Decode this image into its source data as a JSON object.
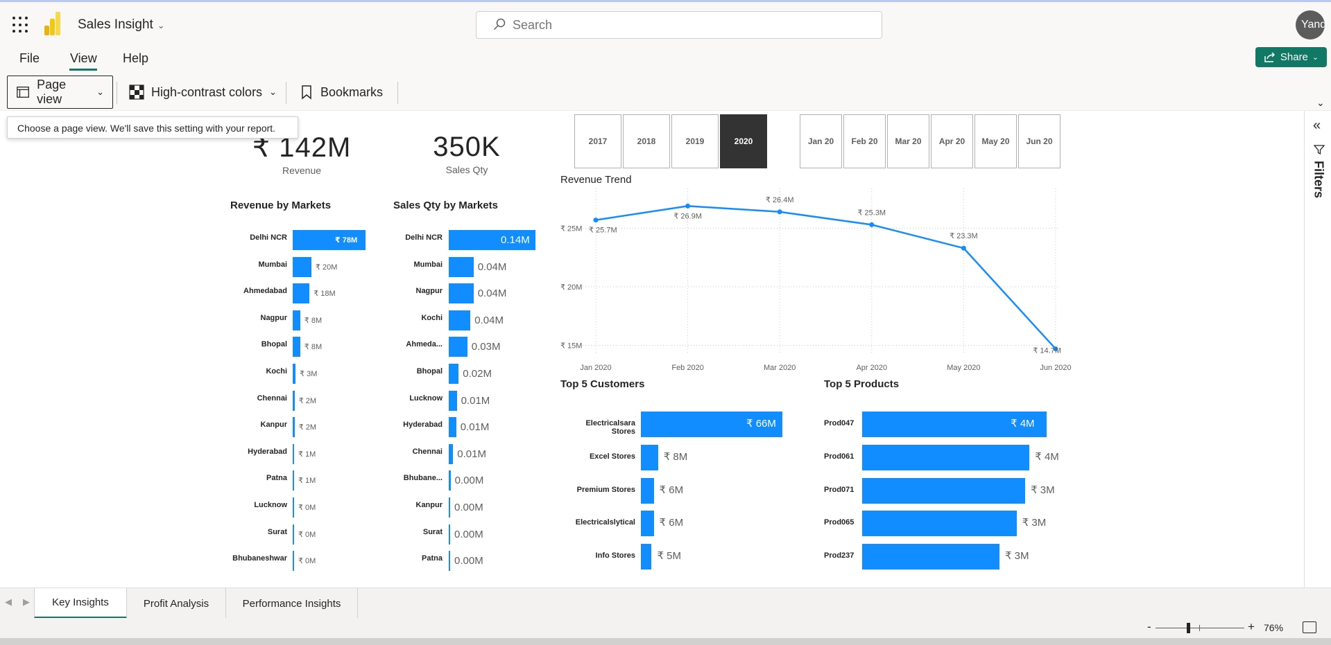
{
  "app": {
    "title": "Sales Insight",
    "title_chevron": "chevron-down-icon"
  },
  "search": {
    "placeholder": "Search"
  },
  "user": {
    "avatar_text": "Yandefir"
  },
  "menu": {
    "items": [
      "File",
      "View",
      "Help"
    ],
    "active": "View",
    "share_label": "Share"
  },
  "toolbar": {
    "page_view_label": "Page view",
    "high_contrast_label": "High-contrast colors",
    "bookmarks_label": "Bookmarks",
    "tooltip": "Choose a page view. We'll save this setting with your report."
  },
  "filters": {
    "label": "Filters"
  },
  "kpis": [
    {
      "value": "₹ 142M",
      "label": "Revenue"
    },
    {
      "value": "350K",
      "label": "Sales Qty"
    }
  ],
  "year_slicer": {
    "options": [
      "2017",
      "2018",
      "2019",
      "2020"
    ],
    "selected": "2020"
  },
  "month_slicer": {
    "options": [
      "Jan 20",
      "Feb 20",
      "Mar 20",
      "Apr 20",
      "May 20",
      "Jun 20"
    ]
  },
  "revenue_by_markets": {
    "title": "Revenue by Markets",
    "rows": [
      {
        "label": "Delhi NCR",
        "value": 78,
        "text": "₹ 78M"
      },
      {
        "label": "Mumbai",
        "value": 20,
        "text": "₹ 20M"
      },
      {
        "label": "Ahmedabad",
        "value": 18,
        "text": "₹ 18M"
      },
      {
        "label": "Nagpur",
        "value": 8,
        "text": "₹ 8M"
      },
      {
        "label": "Bhopal",
        "value": 8,
        "text": "₹ 8M"
      },
      {
        "label": "Kochi",
        "value": 3,
        "text": "₹ 3M"
      },
      {
        "label": "Chennai",
        "value": 2,
        "text": "₹ 2M"
      },
      {
        "label": "Kanpur",
        "value": 2,
        "text": "₹ 2M"
      },
      {
        "label": "Hyderabad",
        "value": 1,
        "text": "₹ 1M"
      },
      {
        "label": "Patna",
        "value": 1,
        "text": "₹ 1M"
      },
      {
        "label": "Lucknow",
        "value": 0.2,
        "text": "₹ 0M"
      },
      {
        "label": "Surat",
        "value": 0.2,
        "text": "₹ 0M"
      },
      {
        "label": "Bhubaneshwar",
        "value": 0.2,
        "text": "₹ 0M"
      }
    ]
  },
  "sales_qty_by_markets": {
    "title": "Sales Qty by Markets",
    "rows": [
      {
        "label": "Delhi NCR",
        "value": 0.14,
        "text": "0.14M"
      },
      {
        "label": "Mumbai",
        "value": 0.04,
        "text": "0.04M"
      },
      {
        "label": "Nagpur",
        "value": 0.04,
        "text": "0.04M"
      },
      {
        "label": "Kochi",
        "value": 0.035,
        "text": "0.04M"
      },
      {
        "label": "Ahmeda...",
        "value": 0.03,
        "text": "0.03M"
      },
      {
        "label": "Bhopal",
        "value": 0.016,
        "text": "0.02M"
      },
      {
        "label": "Lucknow",
        "value": 0.013,
        "text": "0.01M"
      },
      {
        "label": "Hyderabad",
        "value": 0.012,
        "text": "0.01M"
      },
      {
        "label": "Chennai",
        "value": 0.007,
        "text": "0.01M"
      },
      {
        "label": "Bhubane...",
        "value": 0.003,
        "text": "0.00M"
      },
      {
        "label": "Kanpur",
        "value": 0.002,
        "text": "0.00M"
      },
      {
        "label": "Surat",
        "value": 0.002,
        "text": "0.00M"
      },
      {
        "label": "Patna",
        "value": 0.002,
        "text": "0.00M"
      }
    ]
  },
  "chart_data": [
    {
      "type": "line",
      "title": "Revenue Trend",
      "x": [
        "Jan 2020",
        "Feb 2020",
        "Mar 2020",
        "Apr 2020",
        "May 2020",
        "Jun 2020"
      ],
      "series": [
        {
          "values": [
            25.7,
            26.9,
            26.4,
            25.3,
            23.3,
            14.7
          ]
        }
      ],
      "data_labels": [
        "₹ 25.7M",
        "₹ 26.9M",
        "₹ 26.4M",
        "₹ 25.3M",
        "₹ 23.3M",
        "₹ 14.7M"
      ],
      "y_ticks": [
        15,
        20,
        25
      ],
      "y_tick_labels": [
        "₹ 15M",
        "₹ 20M",
        "₹ 25M"
      ],
      "ylim": [
        14.2,
        28.4
      ],
      "grid": true,
      "color": "#118dff"
    },
    {
      "type": "bar",
      "orientation": "horizontal",
      "title": "Top 5 Customers",
      "categories": [
        "Electricalsara Stores",
        "Excel Stores",
        "Premium Stores",
        "Electricalslytical",
        "Info Stores"
      ],
      "values": [
        66,
        8,
        6,
        6,
        5
      ],
      "data_labels": [
        "₹ 66M",
        "₹ 8M",
        "₹ 6M",
        "₹ 6M",
        "₹ 5M"
      ],
      "color": "#118dff"
    },
    {
      "type": "bar",
      "orientation": "horizontal",
      "title": "Top 5 Products",
      "categories": [
        "Prod047",
        "Prod061",
        "Prod071",
        "Prod065",
        "Prod237"
      ],
      "values": [
        4.3,
        3.9,
        3.8,
        3.6,
        3.2
      ],
      "data_labels": [
        "₹ 4M",
        "₹ 4M",
        "₹ 3M",
        "₹ 3M",
        "₹ 3M"
      ],
      "color": "#118dff"
    }
  ],
  "pages": {
    "tabs": [
      "Key Insights",
      "Profit Analysis",
      "Performance Insights"
    ],
    "active": "Key Insights"
  },
  "status": {
    "zoom": "76%",
    "zoom_minus": "-",
    "zoom_plus": "+"
  },
  "colors": {
    "accent": "#117865",
    "bar": "#118dff",
    "slicer_selected": "#333333"
  }
}
